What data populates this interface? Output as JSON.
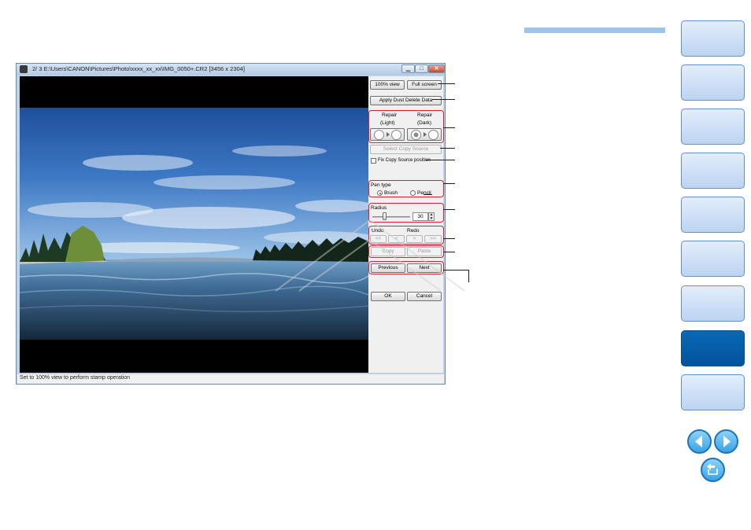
{
  "window": {
    "title": "2/ 3  E:\\Users\\CANON\\Pictures\\Photo\\xxxx_xx_xx\\IMG_0050+.CR2 [3456 x 2304]",
    "minimize_glyph": "▁",
    "maximize_glyph": "□",
    "close_glyph": "✕"
  },
  "panel": {
    "view_100_label": "100% view",
    "fullscreen_label": "Full screen",
    "apply_dust_label": "Apply Dust Delete Data",
    "repair_light_label": "Repair",
    "repair_light_sub": "(Light)",
    "repair_dark_label": "Repair",
    "repair_dark_sub": "(Dark)",
    "select_copy_source_label": "Select Copy Source",
    "fix_copy_source_label": "Fix Copy Source position",
    "pen_type_label": "Pen type",
    "brush_label": "Brush",
    "pencil_label": "Pencil",
    "pen_type_selected": "Brush",
    "radius_label": "Radius",
    "radius_value": "30",
    "undo_label": "Undo",
    "redo_label": "Redo",
    "undo_all_label": "<<",
    "undo_one_label": "<",
    "redo_one_label": ">",
    "redo_all_label": ">>",
    "copy_label": "Copy",
    "paste_label": "Paste",
    "previous_label": "Previous",
    "next_label": "Next",
    "ok_label": "OK",
    "cancel_label": "Cancel"
  },
  "status": {
    "text": "Set to 100% view to perform stamp operation"
  },
  "colors": {
    "highlight": "#e0202c",
    "nav_tab": "#bcd3f2",
    "nav_tab_active": "#0b69b5",
    "header_bar": "#9fc4ec"
  },
  "nav": {
    "tabs": [
      {
        "label": ""
      },
      {
        "label": ""
      },
      {
        "label": ""
      },
      {
        "label": ""
      },
      {
        "label": ""
      },
      {
        "label": ""
      },
      {
        "label": ""
      },
      {
        "label": "",
        "active": true
      },
      {
        "label": ""
      }
    ],
    "prev_icon": "left-arrow-icon",
    "next_icon": "right-arrow-icon",
    "return_icon": "return-icon"
  }
}
